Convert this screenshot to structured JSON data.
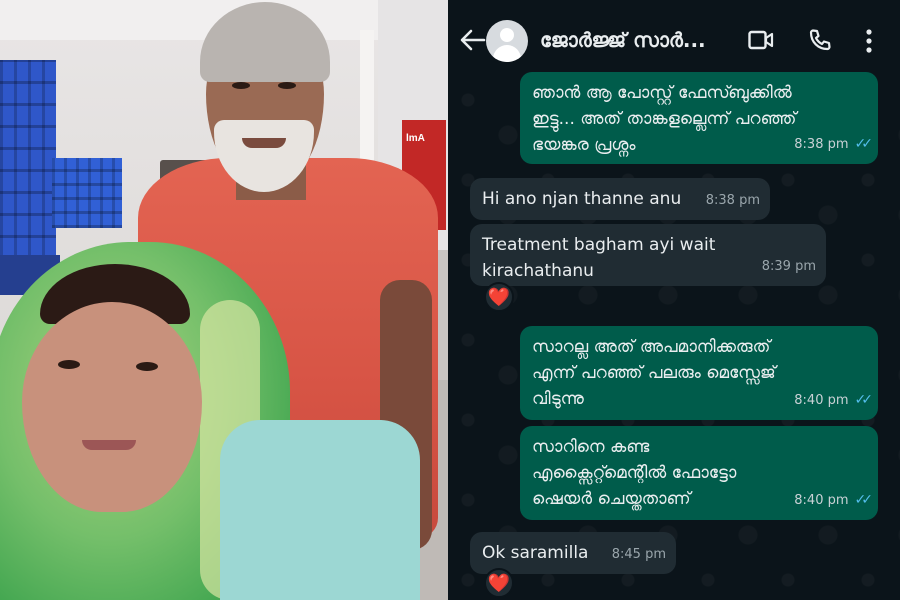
{
  "header": {
    "contact_name": "ജോർജ്ജ് സാർ...",
    "back_icon": "back-arrow-icon",
    "video_icon": "video-call-icon",
    "call_icon": "phone-call-icon",
    "menu_icon": "more-vertical-icon"
  },
  "photo": {
    "poster_text": "lmA"
  },
  "messages": [
    {
      "direction": "out",
      "text": "ഞാൻ ആ പോസ്റ്റ് ഫേസ്ബുക്കിൽ\nഇട്ടു... അത് താങ്കളല്ലെന്ന് പറഞ്ഞ്\nഭയങ്കര പ്രശ്നം",
      "time": "8:38 pm",
      "status": "read"
    },
    {
      "direction": "in",
      "text": "Hi ano njan thanne anu",
      "time": "8:38 pm"
    },
    {
      "direction": "in",
      "text": "Treatment bagham ayi wait\nkirachathanu",
      "time": "8:39 pm",
      "reaction": "❤️"
    },
    {
      "direction": "out",
      "text": "സാറല്ല അത് അപമാനിക്കരുത്\nഎന്ന് പറഞ്ഞ് പലരും മെസ്സേജ്\nവിടുന്നു",
      "time": "8:40 pm",
      "status": "read"
    },
    {
      "direction": "out",
      "text": "സാറിനെ കണ്ട\nഎക്സൈറ്റ്മെന്റിൽ ഫോട്ടോ\nഷെയർ ചെയ്തതാണ്",
      "time": "8:40 pm",
      "status": "read"
    },
    {
      "direction": "in",
      "text": "Ok saramilla",
      "time": "8:45 pm",
      "reaction": "❤️"
    }
  ],
  "colors": {
    "chat_bg": "#0b141a",
    "outgoing_bubble": "#005c4b",
    "incoming_bubble": "#202c33",
    "read_ticks": "#53bdeb",
    "reaction_heart": "#e53945"
  }
}
